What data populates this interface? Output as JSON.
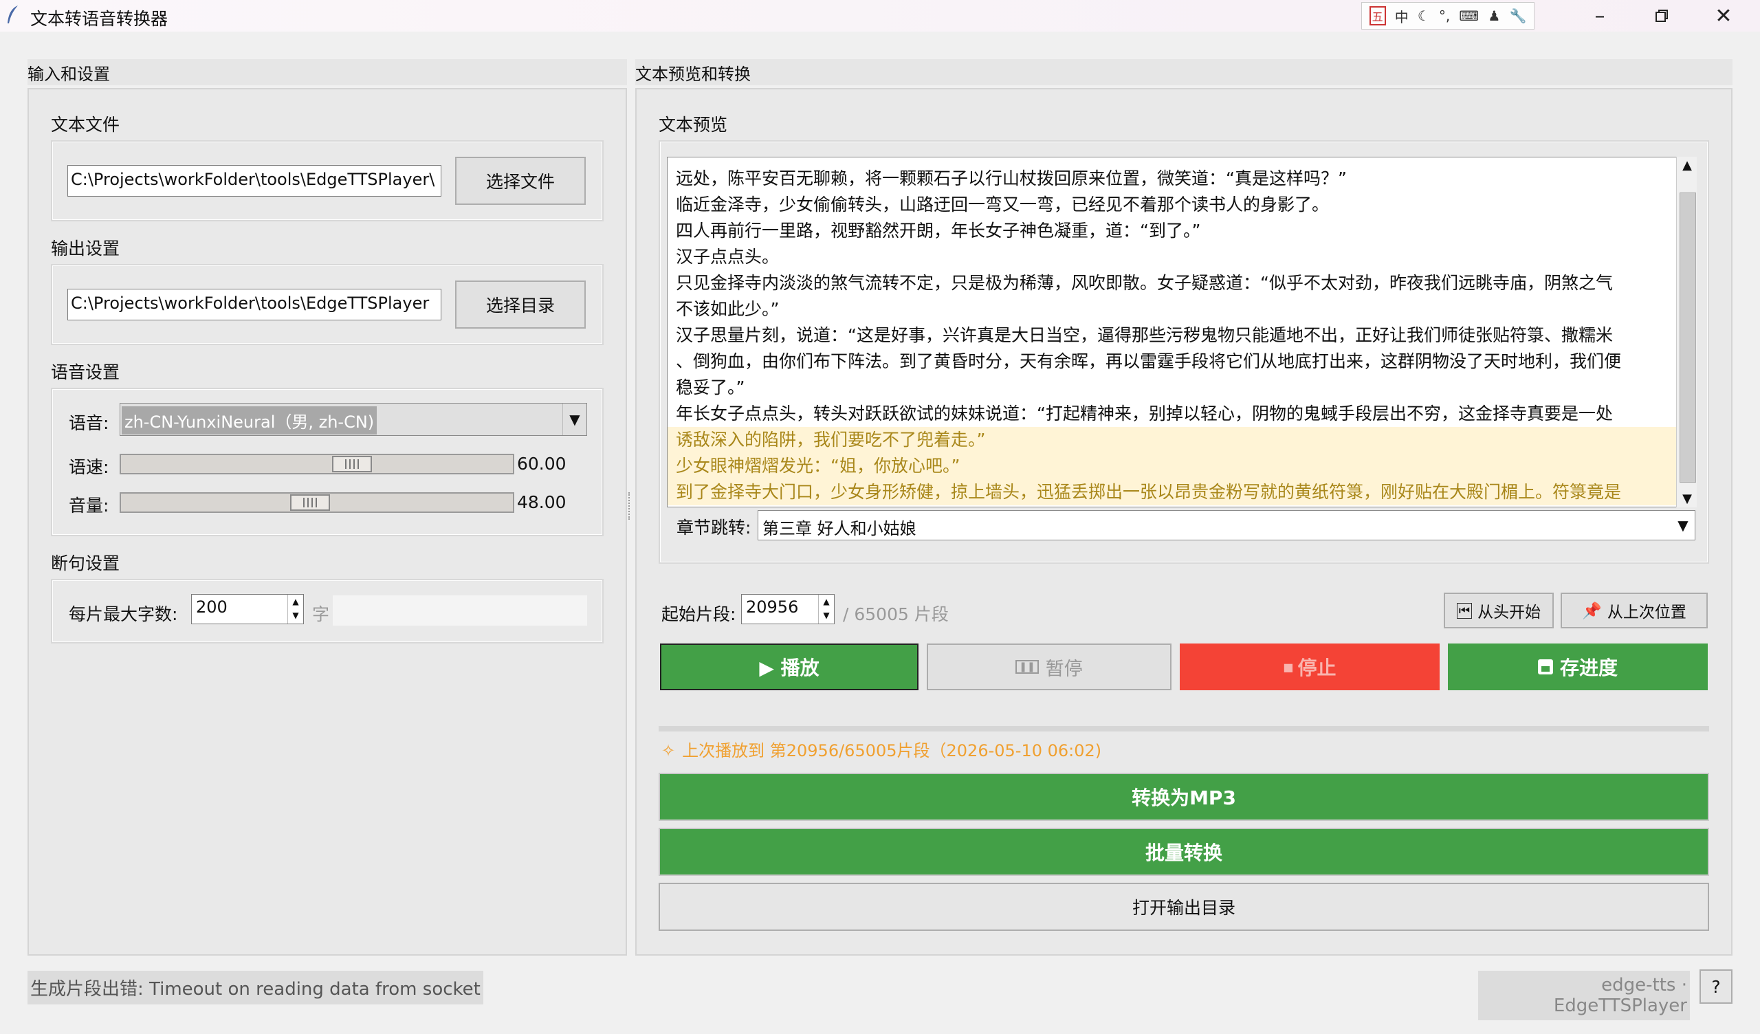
{
  "window": {
    "title": "文本转语音转换器",
    "ime": [
      "中",
      "☾",
      "°,",
      "⌨",
      "♟",
      "🔧"
    ]
  },
  "left": {
    "frame_title": "输入和设置",
    "text_file": {
      "label": "文本文件",
      "path": "C:\\Projects\\workFolder\\tools\\EdgeTTSPlayer\\",
      "button": "选择文件"
    },
    "output": {
      "label": "输出设置",
      "path": "C:\\Projects\\workFolder\\tools\\EdgeTTSPlayer",
      "button": "选择目录"
    },
    "voice": {
      "label": "语音设置",
      "voice_label": "语音:",
      "voice_value": "zh-CN-YunxiNeural（男, zh-CN)",
      "rate_label": "语速:",
      "rate_value": "60.00",
      "rate_fraction": 0.6,
      "volume_label": "音量:",
      "volume_value": "48.00",
      "volume_fraction": 0.48
    },
    "split": {
      "label": "断句设置",
      "max_label": "每片最大字数:",
      "max_value": "200",
      "unit": "字"
    }
  },
  "right": {
    "frame_title": "文本预览和转换",
    "preview_label": "文本预览",
    "lines": [
      {
        "text": "远处，陈平安百无聊赖，将一颗颗石子以行山杖拨回原来位置，微笑道：“真是这样吗？”",
        "hl": false
      },
      {
        "text": "临近金泽寺，少女偷偷转头，山路迂回一弯又一弯，已经见不着那个读书人的身影了。",
        "hl": false
      },
      {
        "text": "四人再前行一里路，视野豁然开朗，年长女子神色凝重，道：“到了。”",
        "hl": false
      },
      {
        "text": "汉子点点头。",
        "hl": false
      },
      {
        "text": "只见金择寺内淡淡的煞气流转不定，只是极为稀薄，风吹即散。女子疑惑道：“似乎不太对劲，昨夜我们远眺寺庙，阴煞之气",
        "hl": false
      },
      {
        "text": "不该如此少。”",
        "hl": false
      },
      {
        "text": "汉子思量片刻，说道：“这是好事，兴许真是大日当空，逼得那些污秽鬼物只能遁地不出，正好让我们师徒张贴符箓、撒糯米",
        "hl": false
      },
      {
        "text": "、倒狗血，由你们布下阵法。到了黄昏时分，天有余晖，再以雷霆手段将它们从地底打出来，这群阴物没了天时地利，我们便",
        "hl": false
      },
      {
        "text": "稳妥了。”",
        "hl": false
      },
      {
        "text": "年长女子点点头，转头对跃跃欲试的妹妹说道：“打起精神来，别掉以轻心，阴物的鬼蜮手段层出不穷，这金择寺真要是一处",
        "hl": false
      },
      {
        "text": "诱敌深入的陷阱，我们要吃不了兜着走。”",
        "hl": true
      },
      {
        "text": "少女眼神熠熠发光：“姐，你放心吧。”",
        "hl": true
      },
      {
        "text": "到了金择寺大门口，少女身形矫健，掠上墙头，迅猛丢掷出一张以昂贵金粉写就的黄纸符箓，刚好贴在大殿门楣上。符箓竟是",
        "hl": true
      }
    ],
    "chapter_label": "章节跳转:",
    "chapter_value": "第三章 好人和小姑娘",
    "start_label": "起始片段:",
    "start_value": "20956",
    "total": "/ 65005 片段",
    "from_start": "从头开始",
    "from_last": "从上次位置",
    "play": "▶ 播放",
    "pause": "暂停",
    "stop": "停止",
    "save": "存进度",
    "last_info": "上次播放到 第20956/65005片段（2026-05-10 06:02)",
    "convert_mp3": "转换为MP3",
    "batch": "批量转换",
    "open_dir": "打开输出目录"
  },
  "status": {
    "message": "生成片段出错: Timeout on reading data from socket",
    "info": "edge-tts · EdgeTTSPlayer",
    "help": "?"
  },
  "colors": {
    "green": "#43a047",
    "red": "#f44336",
    "orange": "#f0a030"
  }
}
